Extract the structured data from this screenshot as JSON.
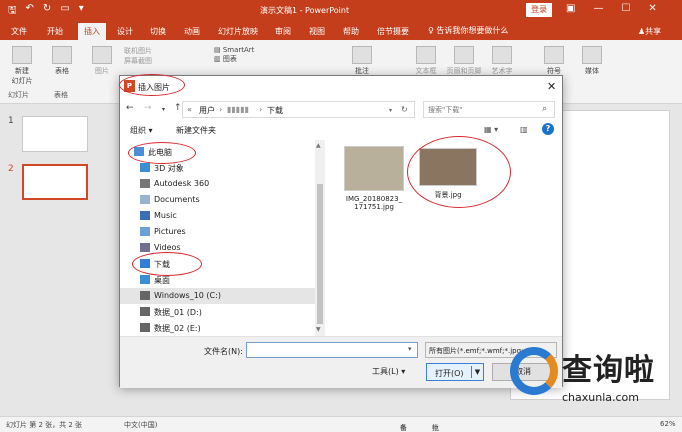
{
  "app": {
    "title": "演示文稿1 - PowerPoint",
    "login": "登录",
    "share": "共享",
    "tell_me": "告诉我你想要做什么"
  },
  "tabs": [
    {
      "label": "文件"
    },
    {
      "label": "开始"
    },
    {
      "label": "插入",
      "active": true
    },
    {
      "label": "设计"
    },
    {
      "label": "切换"
    },
    {
      "label": "动画"
    },
    {
      "label": "幻灯片放映"
    },
    {
      "label": "审阅"
    },
    {
      "label": "视图"
    },
    {
      "label": "帮助"
    },
    {
      "label": "倍节摄要"
    }
  ],
  "ribbon": {
    "new_slide": "新建\n幻灯片",
    "table": "表格",
    "image": "图片",
    "online_pic": "联机图片",
    "screenshot": "屏幕截图",
    "smartart": "SmartArt",
    "chart": "图表",
    "comment": "批注",
    "textbox": "文本框",
    "header_footer": "页眉和页脚",
    "art": "艺术字",
    "symbol": "符号",
    "media": "媒体",
    "group_slides": "幻灯片",
    "group_tables": "表格"
  },
  "thumbnails": [
    {
      "num": "1"
    },
    {
      "num": "2",
      "selected": true
    }
  ],
  "dialog": {
    "title": "插入图片",
    "breadcrumb": [
      "用户",
      "▮▮▮▮▮",
      "下载"
    ],
    "search_placeholder": "搜索\"下载\"",
    "organize": "组织 ▾",
    "new_folder": "新建文件夹",
    "nav_items": [
      {
        "label": "此电脑",
        "icon": "computer-icon",
        "color": "#4a90d9"
      },
      {
        "label": "3D 对象",
        "icon": "cube-icon",
        "color": "#3a8fd6"
      },
      {
        "label": "Autodesk 360",
        "icon": "cloud-icon",
        "color": "#777777"
      },
      {
        "label": "Documents",
        "icon": "document-folder-icon",
        "color": "#9ab3cf"
      },
      {
        "label": "Music",
        "icon": "music-icon",
        "color": "#3a6fb7"
      },
      {
        "label": "Pictures",
        "icon": "pictures-icon",
        "color": "#6aa2d8"
      },
      {
        "label": "Videos",
        "icon": "videos-icon",
        "color": "#6f6f8f"
      },
      {
        "label": "下载",
        "icon": "download-icon",
        "color": "#2f7fd8"
      },
      {
        "label": "桌面",
        "icon": "desktop-icon",
        "color": "#3a8fd6"
      },
      {
        "label": "Windows_10 (C:)",
        "icon": "drive-icon",
        "color": "#666666",
        "selected": true
      },
      {
        "label": "数据_01 (D:)",
        "icon": "drive-icon",
        "color": "#666666"
      },
      {
        "label": "数据_02 (E:)",
        "icon": "drive-icon",
        "color": "#666666"
      }
    ],
    "files": [
      {
        "name": "IMG_20180823_\n171751.jpg",
        "thumb_color": "#b8b09a"
      },
      {
        "name": "背景.jpg",
        "thumb_color": "#8a7660"
      }
    ],
    "filename_label": "文件名(N):",
    "filename_value": "",
    "filetype": "所有图片(*.emf;*.wmf;*.jpg;",
    "tools": "工具(L)  ▾",
    "open": "打开(O)",
    "cancel": "取消"
  },
  "statusbar": {
    "slide_info": "幻灯片 第 2 张，共 2 张",
    "language": "中文(中国)",
    "notes": "备注",
    "comments": "批注",
    "zoom": "62%"
  },
  "watermark": {
    "brand": "查询啦",
    "domain": "chaxunla.com"
  }
}
